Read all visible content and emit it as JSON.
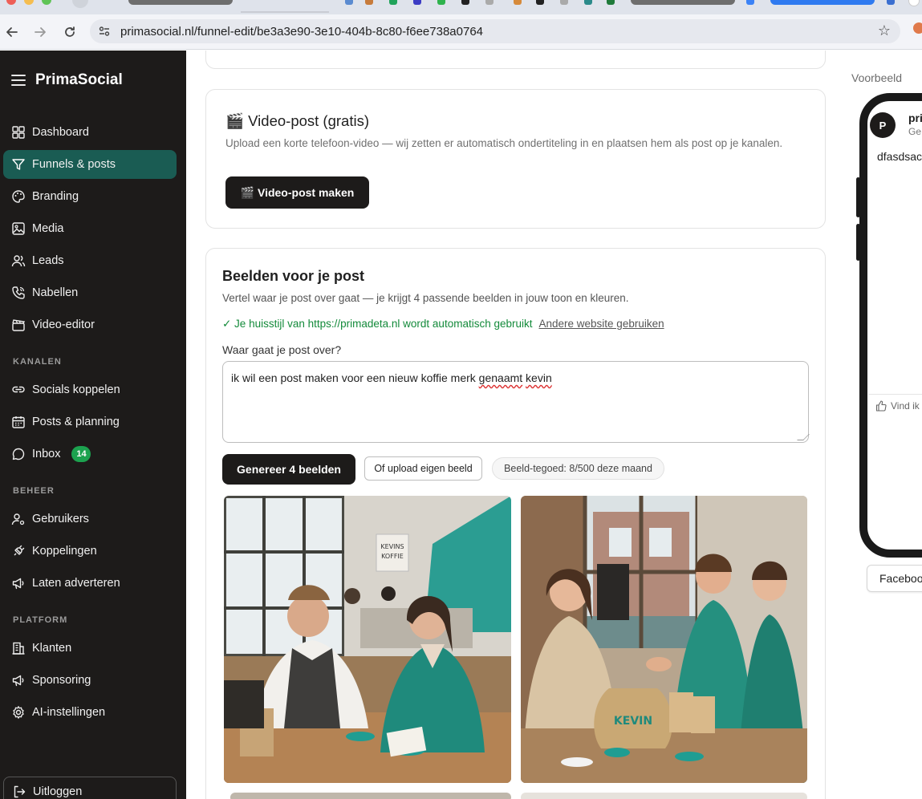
{
  "browser": {
    "url": "primasocial.nl/funnel-edit/be3a3e90-3e10-404b-8c80-f6ee738a0764"
  },
  "sidebar": {
    "brand": "PrimaSocial",
    "items_main": [
      {
        "label": "Dashboard",
        "icon": "grid-icon"
      },
      {
        "label": "Funnels & posts",
        "icon": "funnel-icon",
        "active": true
      },
      {
        "label": "Branding",
        "icon": "palette-icon"
      },
      {
        "label": "Media",
        "icon": "image-icon"
      },
      {
        "label": "Leads",
        "icon": "users-icon"
      },
      {
        "label": "Nabellen",
        "icon": "phone-icon"
      },
      {
        "label": "Video-editor",
        "icon": "clapper-icon"
      }
    ],
    "section_kanalen": "KANALEN",
    "items_kanalen": [
      {
        "label": "Socials koppelen",
        "icon": "link-icon"
      },
      {
        "label": "Posts & planning",
        "icon": "calendar-icon"
      },
      {
        "label": "Inbox",
        "icon": "chat-icon",
        "badge": "14"
      }
    ],
    "section_beheer": "BEHEER",
    "items_beheer": [
      {
        "label": "Gebruikers",
        "icon": "user-settings-icon"
      },
      {
        "label": "Koppelingen",
        "icon": "plug-icon"
      },
      {
        "label": "Laten adverteren",
        "icon": "megaphone-icon"
      }
    ],
    "section_platform": "PLATFORM",
    "items_platform": [
      {
        "label": "Klanten",
        "icon": "building-icon"
      },
      {
        "label": "Sponsoring",
        "icon": "megaphone-icon"
      },
      {
        "label": "AI-instellingen",
        "icon": "gear-icon"
      }
    ],
    "logout": "Uitloggen"
  },
  "video_card": {
    "title": "🎬 Video-post (gratis)",
    "description": "Upload een korte telefoon-video — wij zetten er automatisch ondertiteling in en plaatsen hem als post op je kanalen.",
    "button": "🎬 Video-post maken"
  },
  "images_card": {
    "title": "Beelden voor je post",
    "description": "Vertel waar je post over gaat — je krijgt 4 passende beelden in jouw toon en kleuren.",
    "brand_note": "✓ Je huisstijl van https://primadeta.nl wordt automatisch gebruikt",
    "brand_link": "Andere website gebruiken",
    "field_label": "Waar gaat je post over?",
    "prompt_text_a": "ik wil een post maken voor een nieuw koffie merk ",
    "prompt_text_b": "genaamt",
    "prompt_text_c": " ",
    "prompt_text_d": "kevin",
    "generate_button": "Genereer 4 beelden",
    "upload_button": "Of upload eigen beeld",
    "credits": "Beeld-tegoed: 8/500 deze maand"
  },
  "preview": {
    "label": "Voorbeeld",
    "avatar_letter": "P",
    "account_name": "pri",
    "account_sub": "Ge",
    "post_text": "dfasdsac",
    "like_label": "Vind ik",
    "platform_tab": "Faceboo"
  },
  "colors": {
    "sidebar_bg": "#1d1b1a",
    "accent": "#1a5c53",
    "success": "#138a3a",
    "badge": "#1ca24f"
  }
}
